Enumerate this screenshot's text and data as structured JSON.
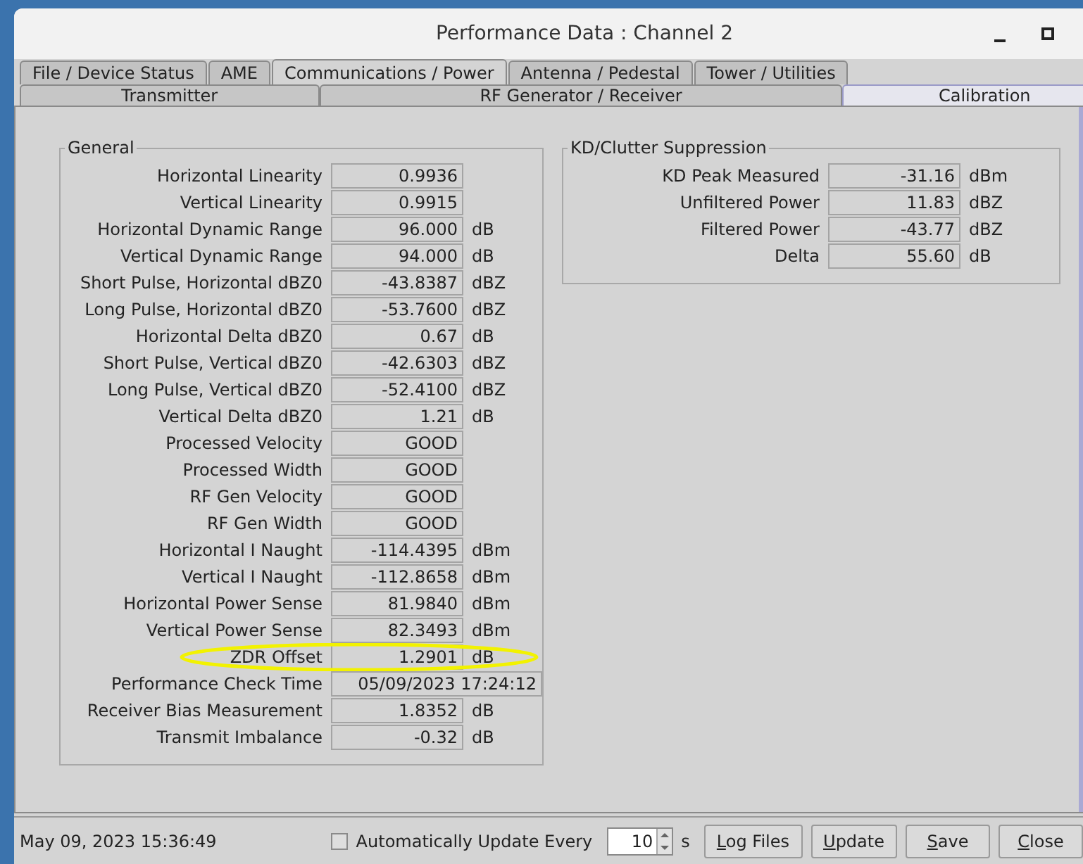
{
  "window": {
    "title": "Performance Data : Channel 2"
  },
  "tabs": [
    {
      "label": "File / Device Status",
      "selected": false
    },
    {
      "label": "AME",
      "selected": false
    },
    {
      "label": "Communications / Power",
      "selected": true
    },
    {
      "label": "Antenna / Pedestal",
      "selected": false
    },
    {
      "label": "Tower / Utilities",
      "selected": false
    }
  ],
  "subtabs": [
    {
      "label": "Transmitter",
      "selected": false
    },
    {
      "label": "RF Generator / Receiver",
      "selected": false
    },
    {
      "label": "Calibration",
      "selected": true
    }
  ],
  "general": {
    "title": "General",
    "rows": [
      {
        "kind": "reading",
        "label": "Horizontal Linearity",
        "value": "0.9936",
        "highlighted": false
      },
      {
        "kind": "reading",
        "label": "Vertical Linearity",
        "value": "0.9915",
        "highlighted": false
      },
      {
        "kind": "reading",
        "label": "Horizontal Dynamic Range",
        "value": "96.000",
        "unit": "dB",
        "highlighted": false
      },
      {
        "kind": "reading",
        "label": "Vertical Dynamic Range",
        "value": "94.000",
        "unit": "dB",
        "highlighted": false
      },
      {
        "kind": "reading",
        "label": "Short Pulse, Horizontal dBZ0",
        "value": "-43.8387",
        "unit": "dBZ",
        "highlighted": false
      },
      {
        "kind": "reading",
        "label": "Long Pulse, Horizontal dBZ0",
        "value": "-53.7600",
        "unit": "dBZ",
        "highlighted": false
      },
      {
        "kind": "reading",
        "label": "Horizontal Delta dBZ0",
        "value": "0.67",
        "unit": "dB",
        "highlighted": false
      },
      {
        "kind": "reading",
        "label": "Short Pulse, Vertical dBZ0",
        "value": "-42.6303",
        "unit": "dBZ",
        "highlighted": false
      },
      {
        "kind": "reading",
        "label": "Long Pulse, Vertical dBZ0",
        "value": "-52.4100",
        "unit": "dBZ",
        "highlighted": false
      },
      {
        "kind": "reading",
        "label": "Vertical Delta dBZ0",
        "value": "1.21",
        "unit": "dB",
        "highlighted": false
      },
      {
        "kind": "reading",
        "label": "Processed Velocity",
        "value": "GOOD",
        "highlighted": false
      },
      {
        "kind": "reading",
        "label": "Processed Width",
        "value": "GOOD",
        "highlighted": false
      },
      {
        "kind": "reading",
        "label": "RF Gen Velocity",
        "value": "GOOD",
        "highlighted": false
      },
      {
        "kind": "reading",
        "label": "RF Gen Width",
        "value": "GOOD",
        "highlighted": false
      },
      {
        "kind": "reading",
        "label": "Horizontal I Naught",
        "value": "-114.4395",
        "unit": "dBm",
        "highlighted": false
      },
      {
        "kind": "reading",
        "label": "Vertical I Naught",
        "value": "-112.8658",
        "unit": "dBm",
        "highlighted": false
      },
      {
        "kind": "reading",
        "label": "Horizontal Power Sense",
        "value": "81.9840",
        "unit": "dBm",
        "highlighted": false
      },
      {
        "kind": "reading",
        "label": "Vertical Power Sense",
        "value": "82.3493",
        "unit": "dBm",
        "highlighted": false
      },
      {
        "kind": "reading",
        "label": "ZDR Offset",
        "value": "1.2901",
        "unit": "dB",
        "highlighted": true
      },
      {
        "kind": "timestamp",
        "label": "Performance Check Time",
        "value": "05/09/2023 17:24:12",
        "highlighted": false
      },
      {
        "kind": "reading",
        "label": "Receiver Bias Measurement",
        "value": "1.8352",
        "unit": "dB",
        "highlighted": false
      },
      {
        "kind": "reading",
        "label": "Transmit Imbalance",
        "value": "-0.32",
        "unit": "dB",
        "highlighted": false
      }
    ]
  },
  "kd_clutter": {
    "title": "KD/Clutter Suppression",
    "rows": [
      {
        "label": "KD Peak Measured",
        "value": "-31.16",
        "unit": "dBm"
      },
      {
        "label": "Unfiltered Power",
        "value": "11.83",
        "unit": "dBZ"
      },
      {
        "label": "Filtered Power",
        "value": "-43.77",
        "unit": "dBZ"
      },
      {
        "label": "Delta",
        "value": "55.60",
        "unit": "dB"
      }
    ]
  },
  "status_bar": {
    "timestamp": "May 09, 2023 15:36:49",
    "auto_update": {
      "label": "Automatically Update Every",
      "checked": false,
      "value": "10",
      "unit": "s"
    },
    "buttons": [
      "Log Files",
      "Update",
      "Save",
      "Close"
    ]
  }
}
